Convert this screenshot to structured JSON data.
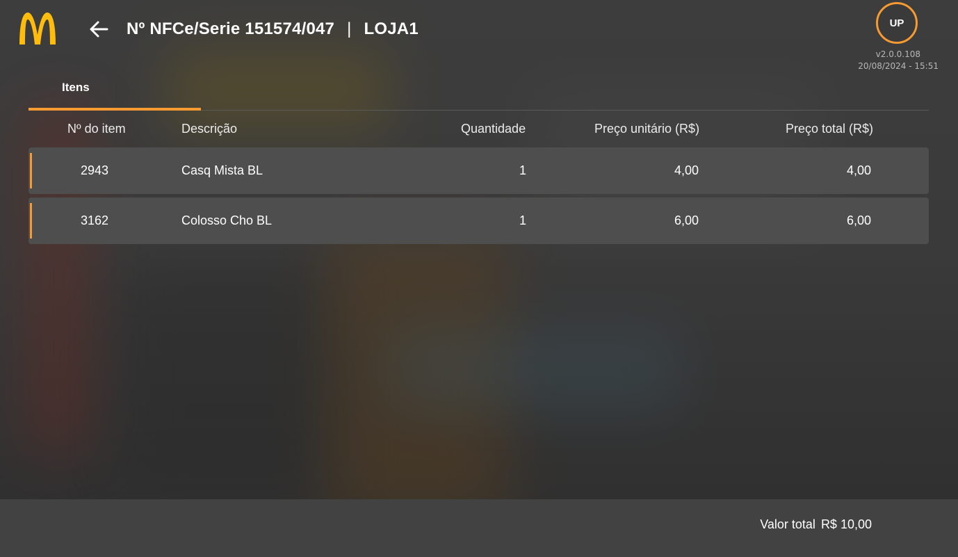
{
  "header": {
    "title": "Nº NFCe/Serie  151574/047",
    "separator": "|",
    "store": "LOJA1",
    "avatar_initials": "UP",
    "version": "v2.0.0.108",
    "datetime": "20/08/2024 - 15:51"
  },
  "icons": {
    "logo": "mcdonalds-arches-logo",
    "back": "arrow-left-icon"
  },
  "colors": {
    "accent": "#f79a32",
    "logo_yellow": "#ffbc0d",
    "row_background": "#4e4e4e",
    "footer_background": "#424242"
  },
  "tabs": [
    {
      "label": "Itens",
      "active": true
    }
  ],
  "table": {
    "columns": [
      "Nº do item",
      "Descrição",
      "Quantidade",
      "Preço unitário (R$)",
      "Preço total (R$)"
    ],
    "rows": [
      {
        "item": "2943",
        "description": "Casq Mista BL",
        "quantity": "1",
        "unit_price": "4,00",
        "total_price": "4,00"
      },
      {
        "item": "3162",
        "description": "Colosso Cho BL",
        "quantity": "1",
        "unit_price": "6,00",
        "total_price": "6,00"
      }
    ]
  },
  "footer": {
    "total_label": "Valor total",
    "total_value": "R$ 10,00"
  }
}
